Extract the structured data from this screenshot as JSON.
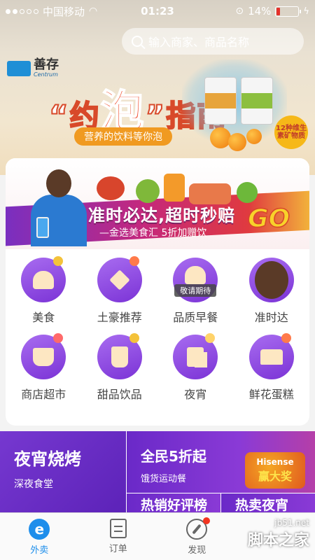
{
  "status_bar": {
    "carrier": "中国移动",
    "time": "01:23",
    "battery": "14%",
    "battery_level": 0.14
  },
  "search": {
    "placeholder": "输入商家、商品名称"
  },
  "hero_banner": {
    "brand": "善存",
    "brand_en": "Centrum",
    "title_a": "“约",
    "title_big": "泡",
    "title_b": "”指南",
    "subtitle": "营养的饮料等你泡",
    "badge": "12种维生素矿物质"
  },
  "promo_banner": {
    "title": "准时必达,超时秒赔",
    "subtitle": "—金选美食汇 5折加赠饮",
    "go": "GO"
  },
  "categories": [
    {
      "label": "美食",
      "icon": "bread-icon"
    },
    {
      "label": "土豪推荐",
      "icon": "diamond-icon"
    },
    {
      "label": "品质早餐",
      "icon": "breakfast-icon",
      "badge": "敬请期待"
    },
    {
      "label": "准时达",
      "icon": "player-avatar-icon"
    },
    {
      "label": "商店超市",
      "icon": "basket-icon"
    },
    {
      "label": "甜品饮品",
      "icon": "drink-icon"
    },
    {
      "label": "夜宵",
      "icon": "beer-icon"
    },
    {
      "label": "鲜花蛋糕",
      "icon": "cake-icon"
    }
  ],
  "tiles": {
    "left": {
      "title": "夜宵烧烤",
      "subtitle": "深夜食堂"
    },
    "right": {
      "title": "全民5折起",
      "subtitle": "饿货运动餐",
      "brand": "Hisense",
      "prize": "赢大奖"
    },
    "small": [
      "热销好评榜",
      "热卖夜宵"
    ]
  },
  "tabbar": {
    "tabs": [
      {
        "label": "外卖",
        "active": true
      },
      {
        "label": "订单",
        "active": false
      },
      {
        "label": "发现",
        "active": false
      }
    ]
  },
  "watermark": {
    "site": "jb51.net",
    "name": "脚本之家"
  },
  "colors": {
    "accent": "#1e8eeb",
    "purple": "#7b33d6",
    "badge_red": "#f2341f"
  }
}
